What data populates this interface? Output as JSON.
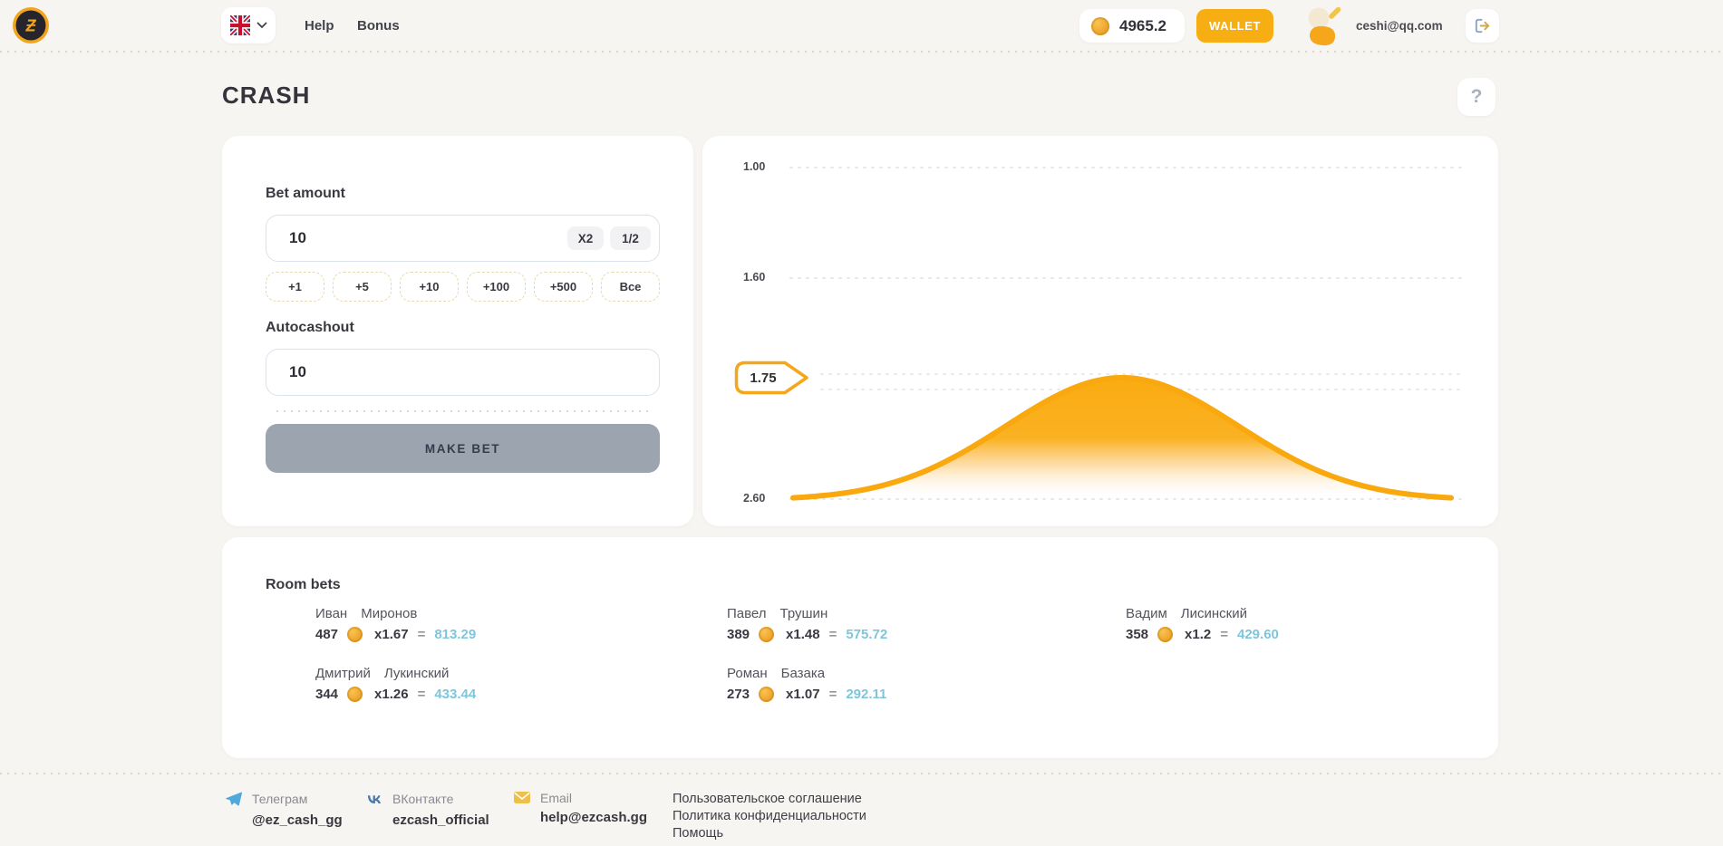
{
  "header": {
    "logo_glyph": "Ƶ",
    "nav": {
      "help": "Help",
      "bonus": "Bonus"
    },
    "balance": {
      "value": "4965.2",
      "icon": "coin-icon"
    },
    "wallet_button": "WALLET",
    "user": {
      "email": "ceshi@qq.com"
    }
  },
  "page": {
    "title": "CRASH",
    "help_button": "?"
  },
  "bet_panel": {
    "bet_amount_label": "Bet amount",
    "bet_amount_value": "10",
    "multiply_button": "X2",
    "half_button": "1/2",
    "quick_buttons": [
      "+1",
      "+5",
      "+10",
      "+100",
      "+500",
      "Все"
    ],
    "autocashout_label": "Autocashout",
    "autocashout_value": "10",
    "make_bet_button": "MAKE BET"
  },
  "chart_data": {
    "type": "area",
    "title": "",
    "y_axis_ticks": [
      "1.00",
      "1.60",
      "2.60"
    ],
    "y_axis_range": [
      1.0,
      2.6
    ],
    "y_axis_direction": "multiplier increases downward (1.00 at top)",
    "current_multiplier": "1.75",
    "grid": "dotted horizontal lines at each tick and at current multiplier",
    "curve": {
      "shape": "gaussian-bell",
      "baseline_multiplier": 2.6,
      "peak_multiplier": 1.75,
      "color": "#f9a80d",
      "fill": "orange fading to transparent toward baseline"
    },
    "legend": null
  },
  "room_bets": {
    "title": "Room bets",
    "equals_sign": "=",
    "bets": [
      {
        "first": "Иван",
        "last": "Миронов",
        "amount": "487",
        "multiplier": "x1.67",
        "result": "813.29"
      },
      {
        "first": "Павел",
        "last": "Трушин",
        "amount": "389",
        "multiplier": "x1.48",
        "result": "575.72"
      },
      {
        "first": "Вадим",
        "last": "Лисинский",
        "amount": "358",
        "multiplier": "x1.2",
        "result": "429.60"
      },
      {
        "first": "Дмитрий",
        "last": "Лукинский",
        "amount": "344",
        "multiplier": "x1.26",
        "result": "433.44"
      },
      {
        "first": "Роман",
        "last": "Базака",
        "amount": "273",
        "multiplier": "x1.07",
        "result": "292.11"
      }
    ]
  },
  "footer": {
    "socials": [
      {
        "label": "Телеграм",
        "value": "@ez_cash_gg",
        "icon": "telegram-icon"
      },
      {
        "label": "ВКонтакте",
        "value": "ezcash_official",
        "icon": "vk-icon"
      },
      {
        "label": "Email",
        "value": "help@ezcash.gg",
        "icon": "email-icon"
      }
    ],
    "links": [
      "Пользовательское соглашение",
      "Политика конфиденциальности",
      "Помощь"
    ]
  },
  "colors": {
    "accent_orange": "#f7ae12",
    "curve_orange": "#f9a80d",
    "page_background": "#f7f5f1",
    "card_background": "#ffffff",
    "result_blue": "#7fc6da",
    "disabled_button_gray": "#9ca4b0"
  }
}
